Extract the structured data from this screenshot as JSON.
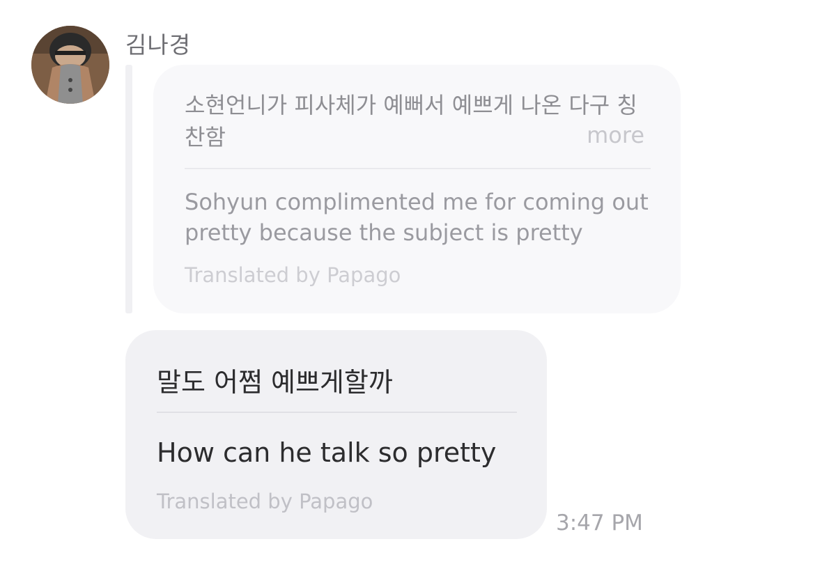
{
  "sender": {
    "name": "김나경",
    "avatar_icon": "profile-photo"
  },
  "quoted_message": {
    "original_text": "소현언니가 피사체가 예뻐서 예쁘게 나온 다구 칭찬함",
    "more_label": "more",
    "translated_text": "Sohyun complimented me for coming out pretty because the subject is pretty",
    "translation_credit": "Translated by Papago"
  },
  "message": {
    "original_text": "말도 어쩜 예쁘게할까",
    "translated_text": "How can he talk so pretty",
    "translation_credit": "Translated by Papago",
    "timestamp": "3:47 PM"
  },
  "colors": {
    "quoted_bubble_bg": "#f8f8fa",
    "message_bubble_bg": "#f1f1f4",
    "reply_bar": "#f0f0f3"
  }
}
